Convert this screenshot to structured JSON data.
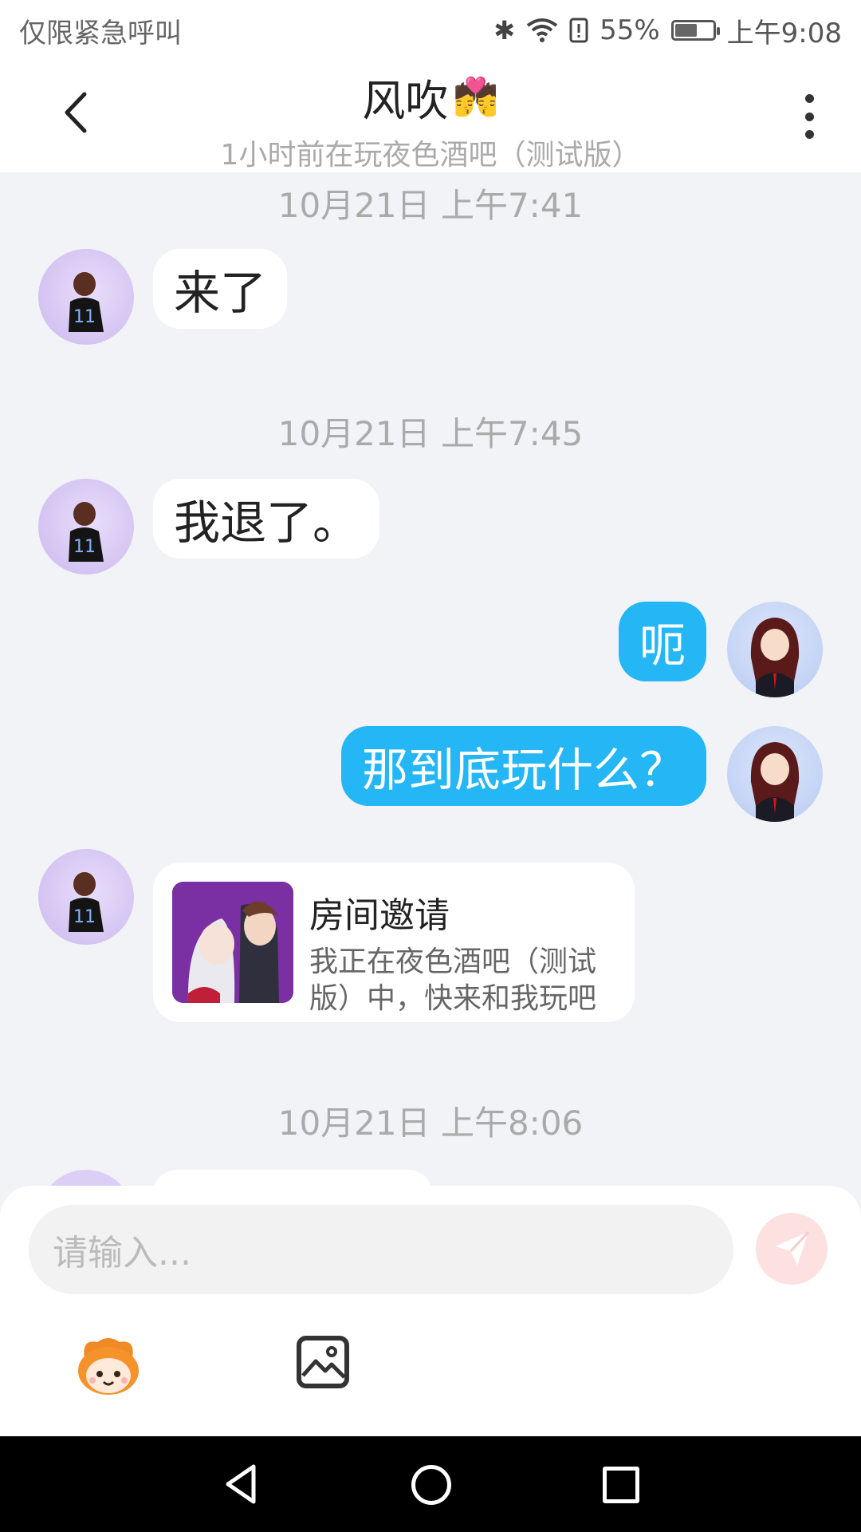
{
  "status_bar": {
    "carrier_text": "仅限紧急呼叫",
    "battery_percent": "55%",
    "battery_level": 0.55,
    "time": "上午9:08",
    "icons": [
      "bluetooth-icon",
      "wifi-icon",
      "alert-icon",
      "battery-icon"
    ]
  },
  "header": {
    "title": "风吹",
    "title_emoji": "💏",
    "subtitle": "1小时前在玩夜色酒吧（测试版）"
  },
  "messages": {
    "ts1": "10月21日 上午7:41",
    "m1": "来了",
    "ts2": "10月21日 上午7:45",
    "m2": "我退了。",
    "m3": "呃",
    "m4": "那到底玩什么？",
    "invite": {
      "title": "房间邀请",
      "desc": "我正在夜色酒吧（测试版）中，快来和我玩吧"
    },
    "ts3": "10月21日 上午8:06"
  },
  "composer": {
    "placeholder": "请输入..."
  },
  "colors": {
    "accent": "#25b6f5",
    "background": "#f1f3f7",
    "send_disabled": "#fde0e0"
  }
}
